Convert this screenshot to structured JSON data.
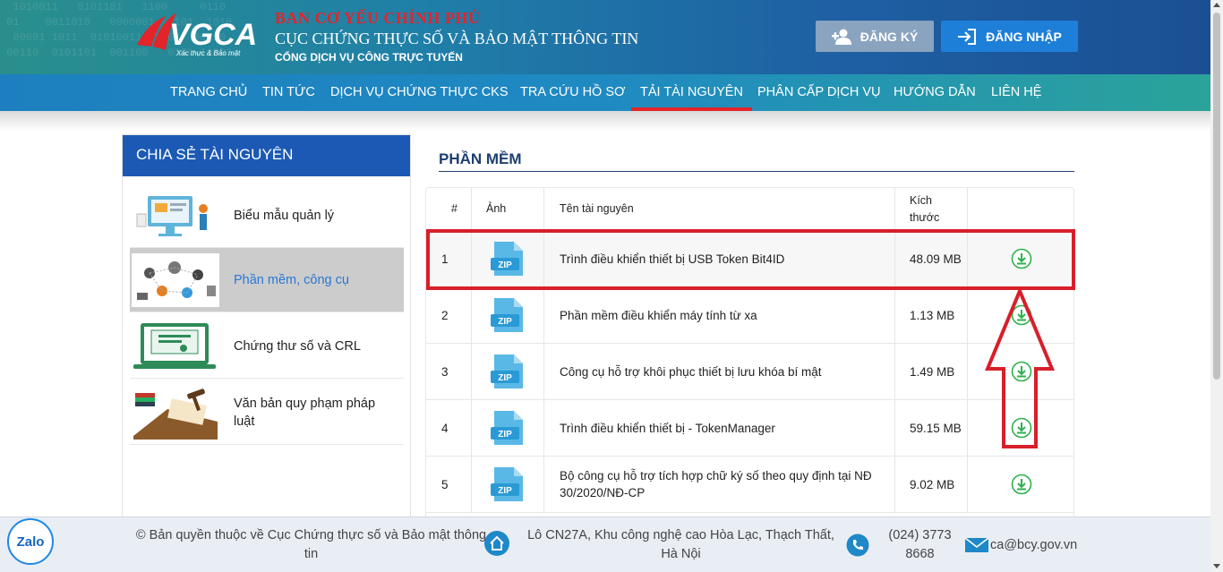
{
  "header": {
    "logo_text": "VGCA",
    "logo_tagline": "Xác thực & Bảo mật",
    "gov_name": "BAN CƠ YẾU CHÍNH PHỦ",
    "org_name": "CỤC CHỨNG THỰC SỐ VÀ BẢO MẬT THÔNG TIN",
    "portal_name": "CỔNG DỊCH VỤ CÔNG TRỰC TUYẾN",
    "register_label": "ĐĂNG KÝ",
    "login_label": "ĐĂNG NHẬP",
    "register_icon": "add-user-icon",
    "login_icon": "login-icon"
  },
  "nav": {
    "items": [
      {
        "label": "TRANG CHỦ"
      },
      {
        "label": "TIN TỨC"
      },
      {
        "label": "DỊCH VỤ CHỨNG THỰC CKS"
      },
      {
        "label": "TRA CỨU HỒ SƠ"
      },
      {
        "label": "TẢI TÀI NGUYÊN"
      },
      {
        "label": "PHÂN CẤP DỊCH VỤ"
      },
      {
        "label": "HƯỚNG DẪN"
      },
      {
        "label": "LIÊN HỆ"
      }
    ],
    "active": "TẢI TÀI NGUYÊN"
  },
  "sidebar": {
    "title": "CHIA SẺ TÀI NGUYÊN",
    "items": [
      {
        "label": "Biểu mẫu quản lý"
      },
      {
        "label": "Phần mềm, công cụ"
      },
      {
        "label": "Chứng thư số và CRL"
      },
      {
        "label": "Văn bản quy phạm pháp luật"
      }
    ],
    "active": "Phần mềm, công cụ"
  },
  "main": {
    "section_title": "PHẦN MỀM",
    "columns": {
      "num": "#",
      "image": "Ảnh",
      "name": "Tên tài nguyên",
      "size": "Kích thước"
    },
    "rows": [
      {
        "num": "1",
        "name": "Trình điều khiển thiết bị USB Token Bit4ID",
        "size": "48.09 MB",
        "file_badge": "ZIP"
      },
      {
        "num": "2",
        "name": "Phần mềm điều khiển máy tính từ xa",
        "size": "1.13 MB",
        "file_badge": "ZIP"
      },
      {
        "num": "3",
        "name": "Công cụ hỗ trợ khôi phục thiết bị lưu khóa bí mật",
        "size": "1.49 MB",
        "file_badge": "ZIP"
      },
      {
        "num": "4",
        "name": "Trình điều khiển thiết bị - TokenManager",
        "size": "59.15 MB",
        "file_badge": "ZIP"
      },
      {
        "num": "5",
        "name": "Bộ công cụ hỗ trợ tích hợp chữ ký số theo quy định tại NĐ 30/2020/NĐ-CP",
        "size": "9.02 MB",
        "file_badge": "ZIP"
      }
    ],
    "download_icon": "download-icon"
  },
  "footer": {
    "copyright": "© Bản quyền thuộc về Cục Chứng thực số và Bảo mật thông tin",
    "address": "Lô CN27A, Khu công nghệ cao Hòa Lạc, Thạch Thất, Hà Nội",
    "phone": "(024) 3773 8668",
    "email": "ca@bcy.gov.vn",
    "zalo_label": "Zalo"
  },
  "colors": {
    "brand_blue": "#1b59b4",
    "highlight_red": "#d81f2a",
    "download_green": "#2bb24c"
  }
}
